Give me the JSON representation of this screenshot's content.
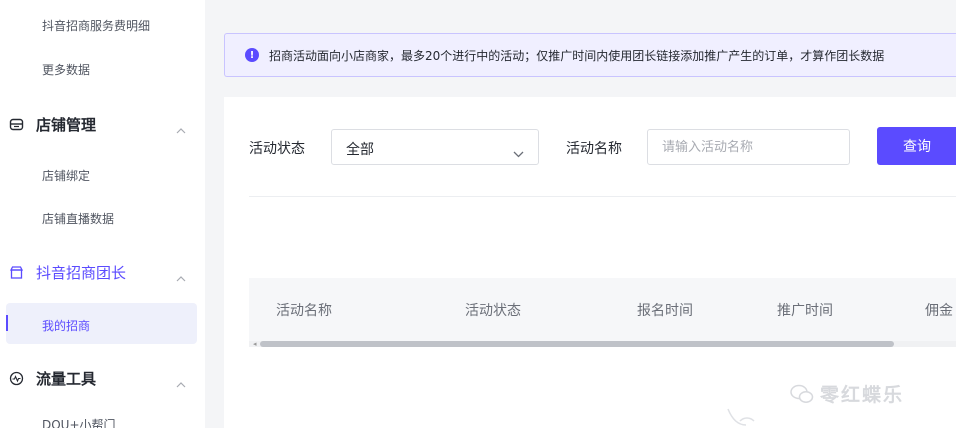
{
  "sidebar": {
    "items_top": [
      {
        "label": "抖音招商服务费明细"
      },
      {
        "label": "更多数据"
      }
    ],
    "groups": [
      {
        "label": "店铺管理",
        "icon": "store-icon",
        "children": [
          "店铺绑定",
          "店铺直播数据"
        ]
      },
      {
        "label": "抖音招商团长",
        "icon": "shop-window-icon",
        "active": true,
        "children": [
          "我的招商"
        ]
      },
      {
        "label": "流量工具",
        "icon": "pulse-icon",
        "children": [
          "DOU+小帮门"
        ]
      }
    ],
    "active_item": "我的招商"
  },
  "notice": {
    "icon": "info-icon",
    "text": "招商活动面向小店商家，最多20个进行中的活动；仅推广时间内使用团长链接添加推广产生的订单，才算作团长数据"
  },
  "filters": {
    "status_label": "活动状态",
    "status_value": "全部",
    "name_label": "活动名称",
    "name_placeholder": "请输入活动名称",
    "query_button": "查询"
  },
  "table": {
    "columns": [
      "活动名称",
      "活动状态",
      "报名时间",
      "推广时间",
      "佣金"
    ]
  },
  "watermark": {
    "text": "零红蝶乐"
  },
  "colors": {
    "accent": "#5b4bff",
    "notice_bg": "#f0efff",
    "active_bg": "#eef0fb"
  }
}
